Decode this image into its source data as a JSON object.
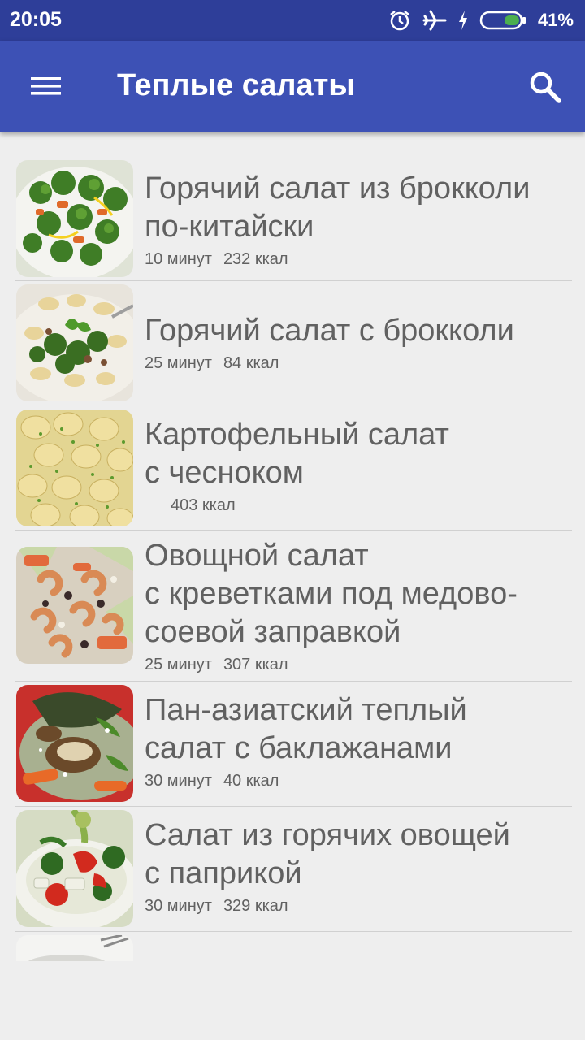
{
  "status_bar": {
    "time": "20:05",
    "battery_percent": "41%",
    "icons": [
      "alarm-icon",
      "airplane-icon",
      "charging-icon",
      "battery-icon"
    ],
    "battery_level": 0.41
  },
  "app_bar": {
    "title": "Теплые салаты",
    "menu_icon": "menu-icon",
    "search_icon": "search-icon",
    "color": "#3d51b5"
  },
  "recipes": [
    {
      "title_lines": [
        "Горячий салат из брокколи",
        "по-китайски"
      ],
      "time": "10 минут",
      "calories": "232 ккал"
    },
    {
      "title_lines": [
        "Горячий салат с брокколи"
      ],
      "time": "25 минут",
      "calories": "84 ккал"
    },
    {
      "title_lines": [
        "Картофельный салат",
        "с чесноком"
      ],
      "time": "",
      "calories": "403 ккал"
    },
    {
      "title_lines": [
        "Овощной салат",
        "с креветками под медово-",
        "соевой заправкой"
      ],
      "time": "25 минут",
      "calories": "307 ккал"
    },
    {
      "title_lines": [
        "Пан-азиатский теплый",
        "салат с баклажанами"
      ],
      "time": "30 минут",
      "calories": "40 ккал"
    },
    {
      "title_lines": [
        "Салат из горячих овощей",
        "с паприкой"
      ],
      "time": "30 минут",
      "calories": "329 ккал"
    }
  ]
}
